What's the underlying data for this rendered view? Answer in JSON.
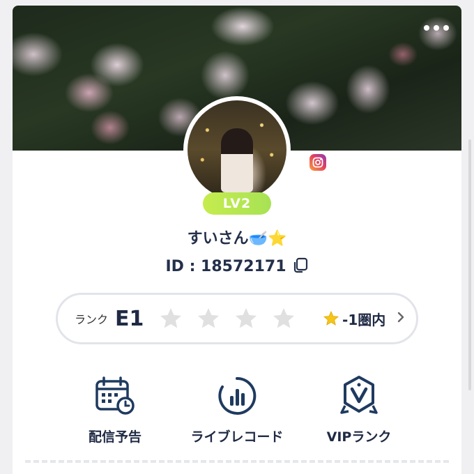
{
  "profile": {
    "level": "LV2",
    "display_name": "すいさん🥣⭐",
    "id_text": "ID : 18572171"
  },
  "rank": {
    "label": "ランク",
    "value": "E1",
    "star_rating": 0,
    "star_max": 5,
    "note": "-1圏内"
  },
  "actions": [
    {
      "label": "配信予告",
      "icon": "calendar-clock-icon"
    },
    {
      "label": "ライブレコード",
      "icon": "bar-chart-circle-icon"
    },
    {
      "label": "VIPランク",
      "icon": "vip-badge-icon"
    }
  ],
  "icons": {
    "more": "more-dots-icon",
    "instagram": "instagram-icon",
    "copy": "copy-icon",
    "chevron": "chevron-right-icon"
  },
  "colors": {
    "level_badge": "#b8e651",
    "text_dark": "#1f2a44",
    "star_inactive": "#e0e0e0",
    "star_active": "#f5c518"
  }
}
